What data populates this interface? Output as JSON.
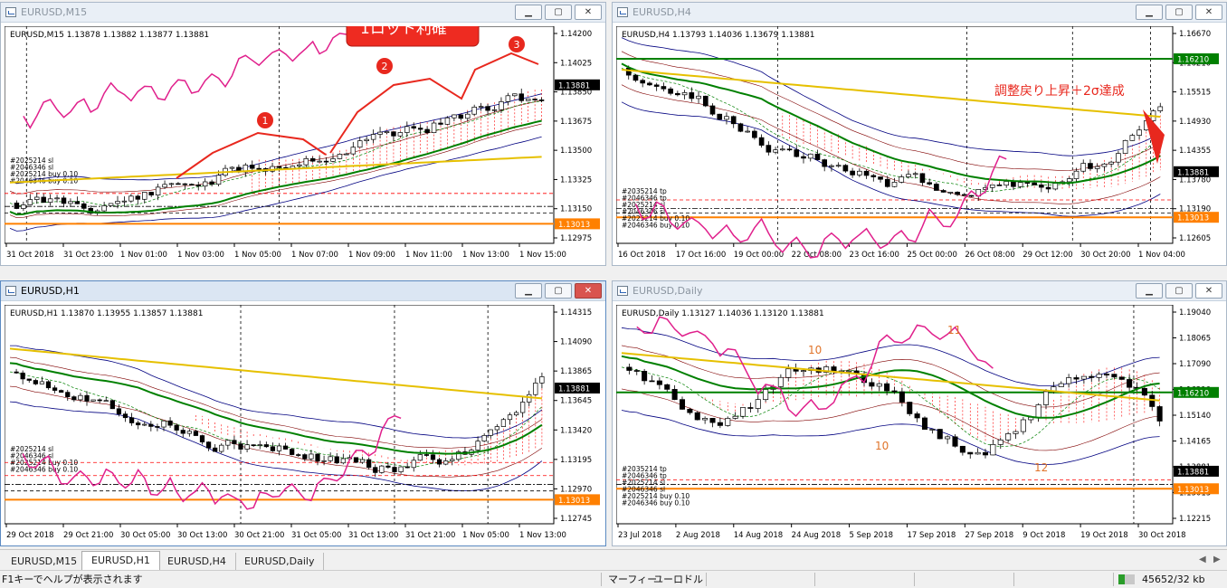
{
  "windows": {
    "m15": {
      "title": "EURUSD,M15",
      "info": "EURUSD,M15  1.13878 1.13882 1.13877 1.13881",
      "prices": [
        "1.14200",
        "1.14025",
        "1.13850",
        "1.13675",
        "1.13500",
        "1.13325",
        "1.13150",
        "1.12975"
      ],
      "current_price": "1.13881",
      "line_price": "1.13013",
      "times": [
        "31 Oct 2018",
        "31 Oct 23:00",
        "1 Nov 01:00",
        "1 Nov 03:00",
        "1 Nov 05:00",
        "1 Nov 07:00",
        "1 Nov 09:00",
        "1 Nov 11:00",
        "1 Nov 13:00",
        "1 Nov 15:00"
      ],
      "labels": [
        "#2025214 sl",
        "#2046346 sl",
        "#2025214 buy 0.10",
        "#2046346 buy 0.10"
      ],
      "callout": "1ロット利確",
      "markers": [
        "1",
        "2",
        "3"
      ]
    },
    "h4": {
      "title": "EURUSD,H4",
      "info": "EURUSD,H4  1.13793 1.14036 1.13679 1.13881",
      "prices": [
        "1.16670",
        "1.16210",
        "1.15515",
        "1.14930",
        "1.14355",
        "1.13780",
        "1.13190",
        "1.12605"
      ],
      "current_price": "1.13881",
      "line_price": "1.13013",
      "green_price": "1.16210",
      "times": [
        "16 Oct 2018",
        "17 Oct 16:00",
        "19 Oct 00:00",
        "22 Oct 08:00",
        "23 Oct 16:00",
        "25 Oct 00:00",
        "26 Oct 08:00",
        "29 Oct 12:00",
        "30 Oct 20:00",
        "1 Nov 04:00"
      ],
      "labels": [
        "#2035214 tp",
        "#2046346 tp",
        "#2025214 sl",
        "#2046346 sl",
        "#2025214 buy 0.10",
        "#2046346 buy 0.10"
      ],
      "annotation": "調整戻り上昇＋2σ達成"
    },
    "h1": {
      "title": "EURUSD,H1",
      "info": "EURUSD,H1  1.13870 1.13955 1.13857 1.13881",
      "prices": [
        "1.14315",
        "1.14090",
        "1.13865",
        "1.13645",
        "1.13420",
        "1.13195",
        "1.12970",
        "1.12745"
      ],
      "current_price": "1.13881",
      "line_price": "1.13013",
      "times": [
        "29 Oct 2018",
        "29 Oct 21:00",
        "30 Oct 05:00",
        "30 Oct 13:00",
        "30 Oct 21:00",
        "31 Oct 05:00",
        "31 Oct 13:00",
        "31 Oct 21:00",
        "1 Nov 05:00",
        "1 Nov 13:00"
      ],
      "labels": [
        "#2025214 sl",
        "#2046346 sl",
        "#2025214 buy 0.10",
        "#2046346 buy 0.10"
      ]
    },
    "daily": {
      "title": "EURUSD,Daily",
      "info": "EURUSD,Daily  1.13127 1.14036 1.13120 1.13881",
      "prices": [
        "1.19040",
        "1.18065",
        "1.17090",
        "1.16210",
        "1.15140",
        "1.14165",
        "1.13881",
        "1.13013",
        "1.12215"
      ],
      "current_price": "1.13881",
      "line_price": "1.13013",
      "green_price": "1.16210",
      "times": [
        "23 Jul 2018",
        "2 Aug 2018",
        "14 Aug 2018",
        "24 Aug 2018",
        "5 Sep 2018",
        "17 Sep 2018",
        "27 Sep 2018",
        "9 Oct 2018",
        "19 Oct 2018",
        "30 Oct 2018"
      ],
      "labels": [
        "#2035214 tp",
        "#2046346 tp",
        "#2025214 sl",
        "#2046346 sl",
        "#2025214 buy 0.10",
        "#2046346 buy 0.10"
      ],
      "counts": [
        "10",
        "11",
        "10",
        "12"
      ]
    }
  },
  "tabs": [
    "EURUSD,M15",
    "EURUSD,H1",
    "EURUSD,H4",
    "EURUSD,Daily"
  ],
  "active_tab": "EURUSD,H1",
  "status": {
    "help": "F1キーでヘルプが表示されます",
    "profile": "マーフィー",
    "template": "ユーロドル",
    "traffic": "45652/32 kb"
  },
  "colors": {
    "bollinger": "#000080",
    "sma_green": "#008000",
    "sma_yellow": "#e6c000",
    "chikou": "#e0208c",
    "cloud": "#ff0000",
    "line_orange": "#ff8000",
    "annotation_red": "#e8281e"
  }
}
